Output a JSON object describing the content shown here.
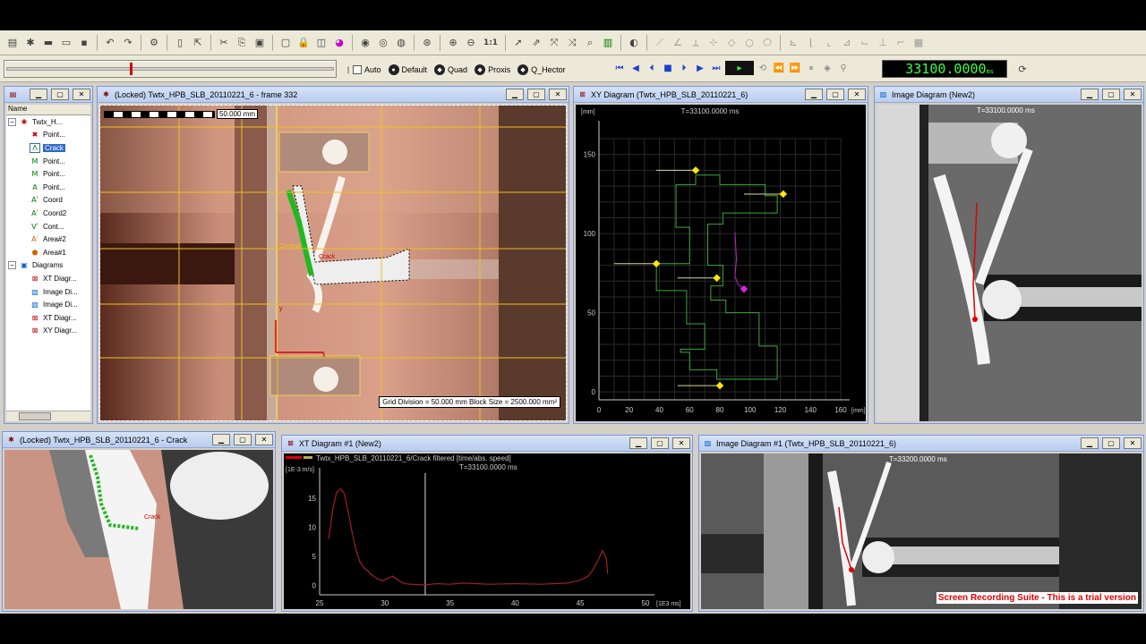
{
  "toolbar": {
    "icons": [
      "open-icon",
      "wizard-icon",
      "case-icon",
      "print-icon",
      "save-icon",
      "undo-icon",
      "redo-icon",
      "settings-icon",
      "document-icon",
      "export-icon",
      "cut-icon",
      "copy-icon",
      "paste-icon",
      "window-icon",
      "lock-icon",
      "image-icon",
      "color-icon",
      "auto-on-icon",
      "auto-off-icon",
      "comment-icon",
      "help-icon",
      "zoom-in-icon",
      "zoom-out-icon",
      "zoom-1to1-icon",
      "select-icon",
      "select-point-icon",
      "select-multi-icon",
      "select-area-icon",
      "find-icon",
      "chart-icon",
      "reset-icon"
    ],
    "zoom_label": "1:1",
    "auto_label": "Auto",
    "default_label": "Default",
    "quad_label": "Quad",
    "proxis_label": "Proxis",
    "qhector_label": "Q_Hector",
    "time_display": "33100.0000",
    "time_unit": "ms"
  },
  "tree": {
    "header": "Name",
    "root_label": "Twtx_H...",
    "items": [
      {
        "icon": "point-icon",
        "label": "Point...",
        "level": 2
      },
      {
        "icon": "crack-icon",
        "label": "Crack",
        "level": 2,
        "selected": true
      },
      {
        "icon": "point-icon",
        "label": "Point...",
        "level": 2
      },
      {
        "icon": "point-icon",
        "label": "Point...",
        "level": 2
      },
      {
        "icon": "point-icon",
        "label": "Point...",
        "level": 2
      },
      {
        "icon": "coord-icon",
        "label": "Coord",
        "level": 2
      },
      {
        "icon": "coord-icon",
        "label": "Coord2",
        "level": 2
      },
      {
        "icon": "contour-icon",
        "label": "Cont...",
        "level": 2
      },
      {
        "icon": "area-icon",
        "label": "Area#2",
        "level": 2
      },
      {
        "icon": "area-icon",
        "label": "Area#1",
        "level": 2
      }
    ],
    "diagrams_label": "Diagrams",
    "diagrams": [
      "XT Diagr...",
      "Image Di...",
      "Image Di...",
      "XT Diagr...",
      "XY Diagr..."
    ]
  },
  "windows": {
    "main": {
      "title": "(Locked) Twtx_HPB_SLB_20110221_6 - frame 332",
      "scale_label": "50.000 mm",
      "grid_info": "Grid Division = 50.000 mm  Block Size = 2500.000 mm²",
      "crack_label": "Crack",
      "contour_label": "Contour",
      "axis_x_label": "x",
      "axis_y_label": "y"
    },
    "xy": {
      "title": "XY Diagram (Twtx_HPB_SLB_20110221_6)",
      "time_label": "T=33100.0000 ms"
    },
    "image_new2": {
      "title": "Image Diagram (New2)",
      "time_label": "T=33100.0000 ms"
    },
    "crack": {
      "title": "(Locked) Twtx_HPB_SLB_20110221_6 - Crack",
      "crack_label": "Crack"
    },
    "xt": {
      "title": "XT Diagram #1 (New2)",
      "series_label": "Twtx_HPB_SLB_20110221_6/Crack filtered [time/abs. speed]",
      "time_label": "T=33100.0000 ms"
    },
    "image1": {
      "title": "Image Diagram #1 (Twtx_HPB_SLB_20110221_6)",
      "time_label": "T=33200.0000 ms",
      "watermark": "Screen Recording Suite - This is a trial version"
    }
  },
  "chart_data": [
    {
      "type": "line",
      "title": "",
      "xlabel": "[mm]",
      "ylabel": "[mm]",
      "xlim": [
        0,
        160
      ],
      "ylim": [
        -5,
        160
      ],
      "xticks": [
        0,
        20,
        40,
        60,
        80,
        100,
        120,
        140,
        160
      ],
      "yticks": [
        0,
        50,
        100,
        150
      ],
      "grid": true,
      "series": [
        {
          "color": "#3aa83a",
          "values_xy": [
            [
              64,
              137
            ],
            [
              80,
              137
            ],
            [
              80,
              131
            ],
            [
              110,
              131
            ],
            [
              110,
              124
            ],
            [
              118,
              124
            ],
            [
              118,
              113
            ],
            [
              82,
              113
            ],
            [
              82,
              106
            ],
            [
              72,
              106
            ],
            [
              72,
              80
            ],
            [
              82,
              80
            ],
            [
              82,
              67
            ],
            [
              74,
              67
            ],
            [
              74,
              58
            ],
            [
              84,
              58
            ],
            [
              84,
              50
            ],
            [
              106,
              50
            ],
            [
              106,
              29
            ],
            [
              118,
              29
            ],
            [
              118,
              8
            ],
            [
              78,
              8
            ],
            [
              78,
              14
            ],
            [
              60,
              14
            ],
            [
              60,
              25
            ],
            [
              54,
              25
            ],
            [
              54,
              27
            ],
            [
              70,
              27
            ],
            [
              70,
              43
            ],
            [
              58,
              43
            ],
            [
              58,
              64
            ],
            [
              38,
              64
            ],
            [
              38,
              81
            ],
            [
              60,
              81
            ],
            [
              60,
              104
            ],
            [
              51,
              104
            ],
            [
              51,
              131
            ],
            [
              64,
              131
            ],
            [
              64,
              137
            ]
          ]
        },
        {
          "color": "#d8d8a0",
          "values_xy": [
            [
              38,
              140
            ],
            [
              64,
              140
            ]
          ]
        },
        {
          "color": "#d8d8a0",
          "values_xy": [
            [
              96,
              125
            ],
            [
              122,
              125
            ]
          ]
        },
        {
          "color": "#d8d8a0",
          "values_xy": [
            [
              10,
              81
            ],
            [
              38,
              81
            ]
          ]
        },
        {
          "color": "#d8d8a0",
          "values_xy": [
            [
              52,
              72
            ],
            [
              78,
              72
            ]
          ]
        },
        {
          "color": "#d8d8a0",
          "values_xy": [
            [
              52,
              4
            ],
            [
              80,
              4
            ]
          ]
        },
        {
          "color": "#c020c0",
          "values_xy": [
            [
              90,
              101
            ],
            [
              91,
              84
            ],
            [
              90,
              73
            ],
            [
              92,
              68
            ],
            [
              96,
              65
            ]
          ]
        }
      ],
      "markers": [
        {
          "color": "#ffe800",
          "x": 64,
          "y": 140
        },
        {
          "color": "#ffe800",
          "x": 122,
          "y": 125
        },
        {
          "color": "#ffe800",
          "x": 38,
          "y": 81
        },
        {
          "color": "#ffe800",
          "x": 78,
          "y": 72
        },
        {
          "color": "#ffe800",
          "x": 80,
          "y": 4
        },
        {
          "color": "#e020e0",
          "x": 96,
          "y": 65
        }
      ]
    },
    {
      "type": "line",
      "title": "",
      "xlabel": "[1E3 ms]",
      "ylabel": "[1E-3 m/s]",
      "xlim": [
        25,
        50
      ],
      "ylim": [
        -1,
        19
      ],
      "xticks": [
        25,
        30,
        35,
        40,
        45,
        50
      ],
      "yticks": [
        0,
        5,
        10,
        15
      ],
      "cursor_x": 33.1,
      "series": [
        {
          "name": "Twtx_HPB_SLB_20110221_6/Crack filtered [time/abs. speed]",
          "color": "#a02020",
          "x": [
            25.7,
            26.0,
            26.3,
            26.6,
            26.9,
            27.2,
            27.5,
            27.8,
            28.1,
            28.4,
            28.7,
            29.0,
            29.4,
            29.8,
            30.2,
            30.6,
            31.0,
            31.5,
            32.0,
            33.0,
            34.0,
            35.0,
            36.0,
            38.0,
            40.0,
            42.0,
            44.0,
            45.0,
            45.6,
            46.0,
            46.4,
            46.7,
            47.0,
            47.1
          ],
          "y": [
            8,
            13,
            16,
            16.6,
            15.8,
            12.5,
            9,
            6,
            4,
            3,
            2.5,
            1.8,
            1.2,
            0.8,
            1.2,
            1.6,
            0.9,
            0.3,
            0.2,
            0.1,
            0.3,
            0.2,
            0.4,
            0.2,
            0.3,
            0.2,
            0.4,
            0.9,
            1.6,
            2.8,
            4.5,
            6,
            4.5,
            2
          ]
        }
      ]
    }
  ]
}
